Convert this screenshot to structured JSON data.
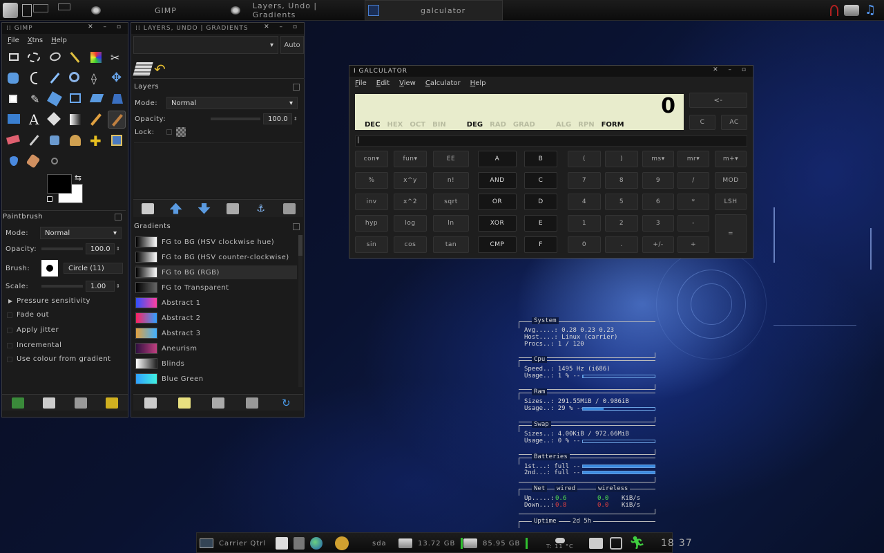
{
  "topbar": {
    "tasks": [
      "GIMP",
      "Layers, Undo | Gradients",
      "galculator"
    ]
  },
  "gimp": {
    "title": "GIMP",
    "menus": [
      "File",
      "Xtns",
      "Help"
    ],
    "paintbrush": {
      "title": "Paintbrush",
      "mode_label": "Mode:",
      "mode_value": "Normal",
      "opacity_label": "Opacity:",
      "opacity_value": "100.0",
      "brush_label": "Brush:",
      "brush_value": "Circle (11)",
      "scale_label": "Scale:",
      "scale_value": "1.00",
      "pressure": "Pressure sensitivity",
      "options": [
        "Fade out",
        "Apply jitter",
        "Incremental",
        "Use colour from gradient"
      ]
    }
  },
  "layers": {
    "title": "LAYERS, UNDO | GRADIENTS",
    "auto_label": "Auto",
    "layers_title": "Layers",
    "mode_label": "Mode:",
    "mode_value": "Normal",
    "opacity_label": "Opacity:",
    "opacity_value": "100.0",
    "lock_label": "Lock:",
    "gradients_title": "Gradients",
    "gradients": [
      {
        "name": "FG to BG (HSV clockwise hue)",
        "colors": [
          "#000000",
          "#ffffff"
        ]
      },
      {
        "name": "FG to BG (HSV counter-clockwise)",
        "colors": [
          "#000000",
          "#ffffff"
        ]
      },
      {
        "name": "FG to BG (RGB)",
        "colors": [
          "#000000",
          "#ffffff"
        ]
      },
      {
        "name": "FG to Transparent",
        "colors": [
          "#000000",
          "#666666"
        ]
      },
      {
        "name": "Abstract 1",
        "colors": [
          "#3050ff",
          "#ff40a0"
        ]
      },
      {
        "name": "Abstract 2",
        "colors": [
          "#ff2060",
          "#30a0ff"
        ]
      },
      {
        "name": "Abstract 3",
        "colors": [
          "#e0a040",
          "#40b0ff"
        ]
      },
      {
        "name": "Aneurism",
        "colors": [
          "#301040",
          "#c04080"
        ]
      },
      {
        "name": "Blinds",
        "colors": [
          "#ffffff",
          "#222222"
        ]
      },
      {
        "name": "Blue Green",
        "colors": [
          "#30a0ff",
          "#40f0e0"
        ]
      }
    ]
  },
  "calculator": {
    "title": "I GALCULATOR",
    "menus": [
      "File",
      "Edit",
      "View",
      "Calculator",
      "Help"
    ],
    "display_value": "0",
    "modes": [
      "DEC",
      "HEX",
      "OCT",
      "BIN",
      "DEG",
      "RAD",
      "GRAD",
      "ALG",
      "RPN",
      "FORM"
    ],
    "top_buttons": [
      "<-",
      "C",
      "AC"
    ],
    "rows": [
      [
        "con",
        "fun",
        "EE",
        "A",
        "B",
        "(",
        ")",
        "ms",
        "mr",
        "m+"
      ],
      [
        "%",
        "x^y",
        "n!",
        "AND",
        "C",
        "7",
        "8",
        "9",
        "/",
        "MOD"
      ],
      [
        "inv",
        "x^2",
        "sqrt",
        "OR",
        "D",
        "4",
        "5",
        "6",
        "*",
        "LSH"
      ],
      [
        "hyp",
        "log",
        "ln",
        "XOR",
        "E",
        "1",
        "2",
        "3",
        "-",
        "="
      ],
      [
        "sin",
        "cos",
        "tan",
        "CMP",
        "F",
        "0",
        ".",
        "+/-",
        "+",
        ""
      ]
    ]
  },
  "conky": {
    "system": {
      "title": "System",
      "avg": "Avg.....: 0.28 0.23 0.23",
      "host": "Host....: Linux (carrier)",
      "procs": "Procs..: 1  / 120"
    },
    "cpu": {
      "title": "Cpu",
      "speed": "Speed..: 1495 Hz (i686)",
      "usage": "Usage..: 1  % --",
      "usage_frac": 0.01
    },
    "ram": {
      "title": "Ram",
      "sizes": "Sizes..: 291.55MiB / 0.986iB",
      "usage": "Usage..: 29 % --",
      "usage_frac": 0.29
    },
    "swap": {
      "title": "Swap",
      "sizes": "Sizes..: 4.00KiB   / 972.66MiB",
      "usage": "Usage..: 0  % --",
      "usage_frac": 0.0
    },
    "batteries": {
      "title": "Batteries",
      "b1": "1st...: full --",
      "b2": "2nd...: full --",
      "b1_frac": 1.0,
      "b2_frac": 1.0
    },
    "net": {
      "title": "Net",
      "wired_label": "wired",
      "wireless_label": "wireless",
      "up_label": "Up.....:",
      "down_label": "Down...:",
      "up_wired": "0.6",
      "down_wired": "0.8",
      "up_wireless": "0.0",
      "down_wireless": "0.0",
      "unit": "KiB/s"
    },
    "uptime": {
      "title": "Uptime",
      "value": "2d 5h"
    }
  },
  "taskbar": {
    "home": "Carrier Qtrl",
    "sda": "sda",
    "disk1": "13.72 GB",
    "disk2": "85.95 GB",
    "temp": "T: 11 °C",
    "clock_h": "18",
    "clock_m": "37"
  }
}
